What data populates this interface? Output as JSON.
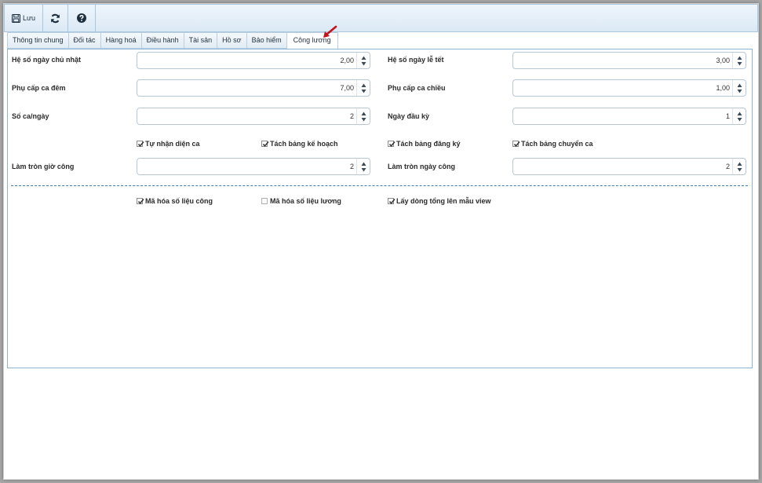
{
  "toolbar": {
    "save_label": "Lưu",
    "icons": [
      "save-icon",
      "refresh-icon",
      "help-icon"
    ]
  },
  "tabs": [
    {
      "label": "Thông tin chung",
      "active": false
    },
    {
      "label": "Đối tác",
      "active": false
    },
    {
      "label": "Hàng hoá",
      "active": false
    },
    {
      "label": "Điều hành",
      "active": false
    },
    {
      "label": "Tài sản",
      "active": false
    },
    {
      "label": "Hồ sơ",
      "active": false
    },
    {
      "label": "Bảo hiểm",
      "active": false
    },
    {
      "label": "Công lương",
      "active": true
    }
  ],
  "fields": {
    "sunday_coef": {
      "label": "Hệ số ngày chủ nhật",
      "value": "2,00"
    },
    "holiday_coef": {
      "label": "Hệ số ngày lễ tết",
      "value": "3,00"
    },
    "night_allowance": {
      "label": "Phụ cấp ca đêm",
      "value": "7,00"
    },
    "afternoon_allowance": {
      "label": "Phụ cấp ca chiều",
      "value": "1,00"
    },
    "shifts_per_day": {
      "label": "Số ca/ngày",
      "value": "2"
    },
    "period_start_day": {
      "label": "Ngày đầu kỳ",
      "value": "1"
    },
    "round_work_hours": {
      "label": "Làm tròn giờ công",
      "value": "2"
    },
    "round_work_days": {
      "label": "Làm tròn ngày công",
      "value": "2"
    }
  },
  "checkboxes_row1": [
    {
      "label": "Tự nhận diện ca",
      "checked": true
    },
    {
      "label": "Tách bảng kế hoạch",
      "checked": true
    },
    {
      "label": "Tách bảng đăng ký",
      "checked": true
    },
    {
      "label": "Tách bảng chuyển ca",
      "checked": true
    }
  ],
  "checkboxes_row2": [
    {
      "label": "Mã hóa số liệu công",
      "checked": true
    },
    {
      "label": "Mã hóa số liệu lương",
      "checked": false
    },
    {
      "label": "Lấy dòng tổng lên mẫu view",
      "checked": true
    }
  ],
  "colors": {
    "accent": "#3e79b2",
    "annotation_arrow": "#c0141b"
  }
}
